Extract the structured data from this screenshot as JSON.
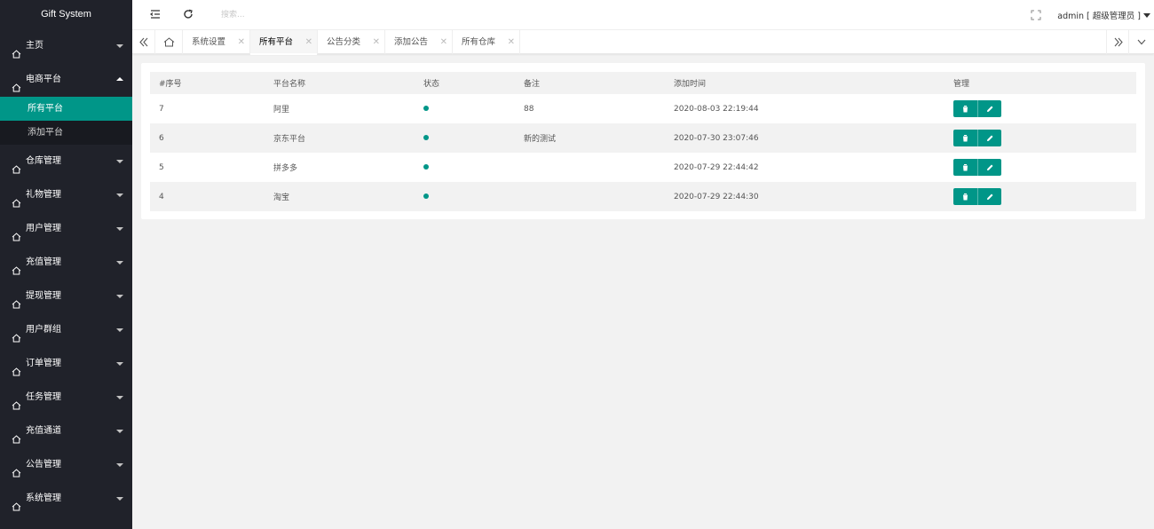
{
  "app": {
    "title": "Gift System"
  },
  "sidebar": {
    "items": [
      {
        "label": "主页",
        "expanded": false
      },
      {
        "label": "电商平台",
        "expanded": true,
        "children": [
          {
            "label": "所有平台",
            "active": true
          },
          {
            "label": "添加平台",
            "active": false
          }
        ]
      },
      {
        "label": "仓库管理",
        "expanded": false
      },
      {
        "label": "礼物管理",
        "expanded": false
      },
      {
        "label": "用户管理",
        "expanded": false
      },
      {
        "label": "充值管理",
        "expanded": false
      },
      {
        "label": "提现管理",
        "expanded": false
      },
      {
        "label": "用户群组",
        "expanded": false
      },
      {
        "label": "订单管理",
        "expanded": false
      },
      {
        "label": "任务管理",
        "expanded": false
      },
      {
        "label": "充值通道",
        "expanded": false
      },
      {
        "label": "公告管理",
        "expanded": false
      },
      {
        "label": "系统管理",
        "expanded": false
      }
    ]
  },
  "header": {
    "search_placeholder": "搜索...",
    "user_label": "admin [ 超级管理员 ]"
  },
  "tabs": [
    {
      "label": "系统设置",
      "active": false
    },
    {
      "label": "所有平台",
      "active": true
    },
    {
      "label": "公告分类",
      "active": false
    },
    {
      "label": "添加公告",
      "active": false
    },
    {
      "label": "所有仓库",
      "active": false
    }
  ],
  "table": {
    "columns": [
      "#序号",
      "平台名称",
      "状态",
      "备注",
      "添加时间",
      "管理"
    ],
    "rows": [
      {
        "id": "7",
        "name": "阿里",
        "remark": "88",
        "time": "2020-08-03 22:19:44"
      },
      {
        "id": "6",
        "name": "京东平台",
        "remark": "新的测试",
        "time": "2020-07-30 23:07:46"
      },
      {
        "id": "5",
        "name": "拼多多",
        "remark": "",
        "time": "2020-07-29 22:44:42"
      },
      {
        "id": "4",
        "name": "淘宝",
        "remark": "",
        "time": "2020-07-29 22:44:30"
      }
    ]
  },
  "colors": {
    "accent": "#009688",
    "sidebar_bg": "#20222a",
    "submenu_bg": "#181a20"
  }
}
